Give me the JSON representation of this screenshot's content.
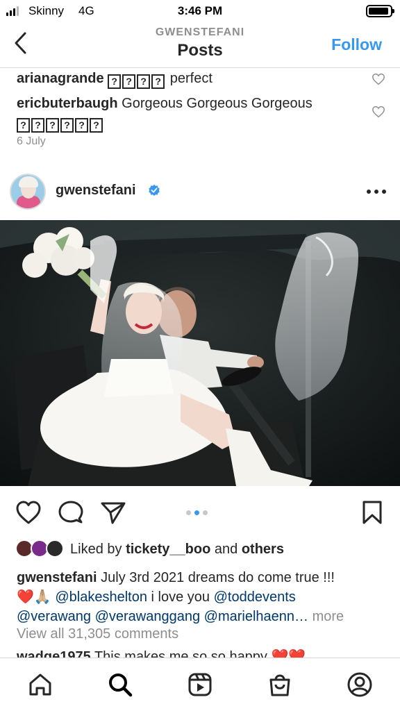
{
  "status_bar": {
    "carrier": "Skinny",
    "network": "4G",
    "time": "3:46 PM"
  },
  "header": {
    "subtitle": "GWENSTEFANI",
    "title": "Posts",
    "follow_label": "Follow"
  },
  "previous_comments": [
    {
      "user": "arianagrande",
      "emoji_glyphs": [
        "?",
        "?",
        "?",
        "?"
      ],
      "text": "perfect"
    },
    {
      "user": "ericbuterbaugh",
      "text": "Gorgeous Gorgeous Gorgeous",
      "emoji_glyphs": [
        "?",
        "?",
        "?",
        "?",
        "?",
        "?"
      ]
    }
  ],
  "previous_date": "6 July",
  "post": {
    "username": "gwenstefani",
    "liked_by_prefix": "Liked by",
    "liked_by_user": "tickety__boo",
    "liked_by_and": "and",
    "liked_by_others": "others",
    "caption_user": "gwenstefani",
    "caption_text": "July 3rd 2021 dreams do come true !!!",
    "caption_emoji": "❤️🙏🏼",
    "mentions": [
      "@blakeshelton",
      "@toddevents",
      "@verawang",
      "@verawanggang",
      "@marielhaenn…"
    ],
    "caption_mid": "i love you",
    "more_label": "more",
    "view_comments": "View all 31,305 comments",
    "peek_comment_user": "wadge1975",
    "peek_comment_text": "This makes me so so happy ❤️❤️",
    "carousel_total": 3,
    "carousel_active": 2
  },
  "icons": {
    "back": "chevron-left-icon",
    "more": "more-options-icon",
    "like": "heart-icon",
    "comment": "comment-icon",
    "share": "share-icon",
    "save": "bookmark-icon",
    "nav": [
      "home-icon",
      "search-icon",
      "reels-icon",
      "shop-icon",
      "profile-icon"
    ]
  },
  "colors": {
    "link_blue": "#3897f0",
    "mention_blue": "#00376b",
    "muted": "#8e8e8e",
    "verified": "#3897f0"
  }
}
